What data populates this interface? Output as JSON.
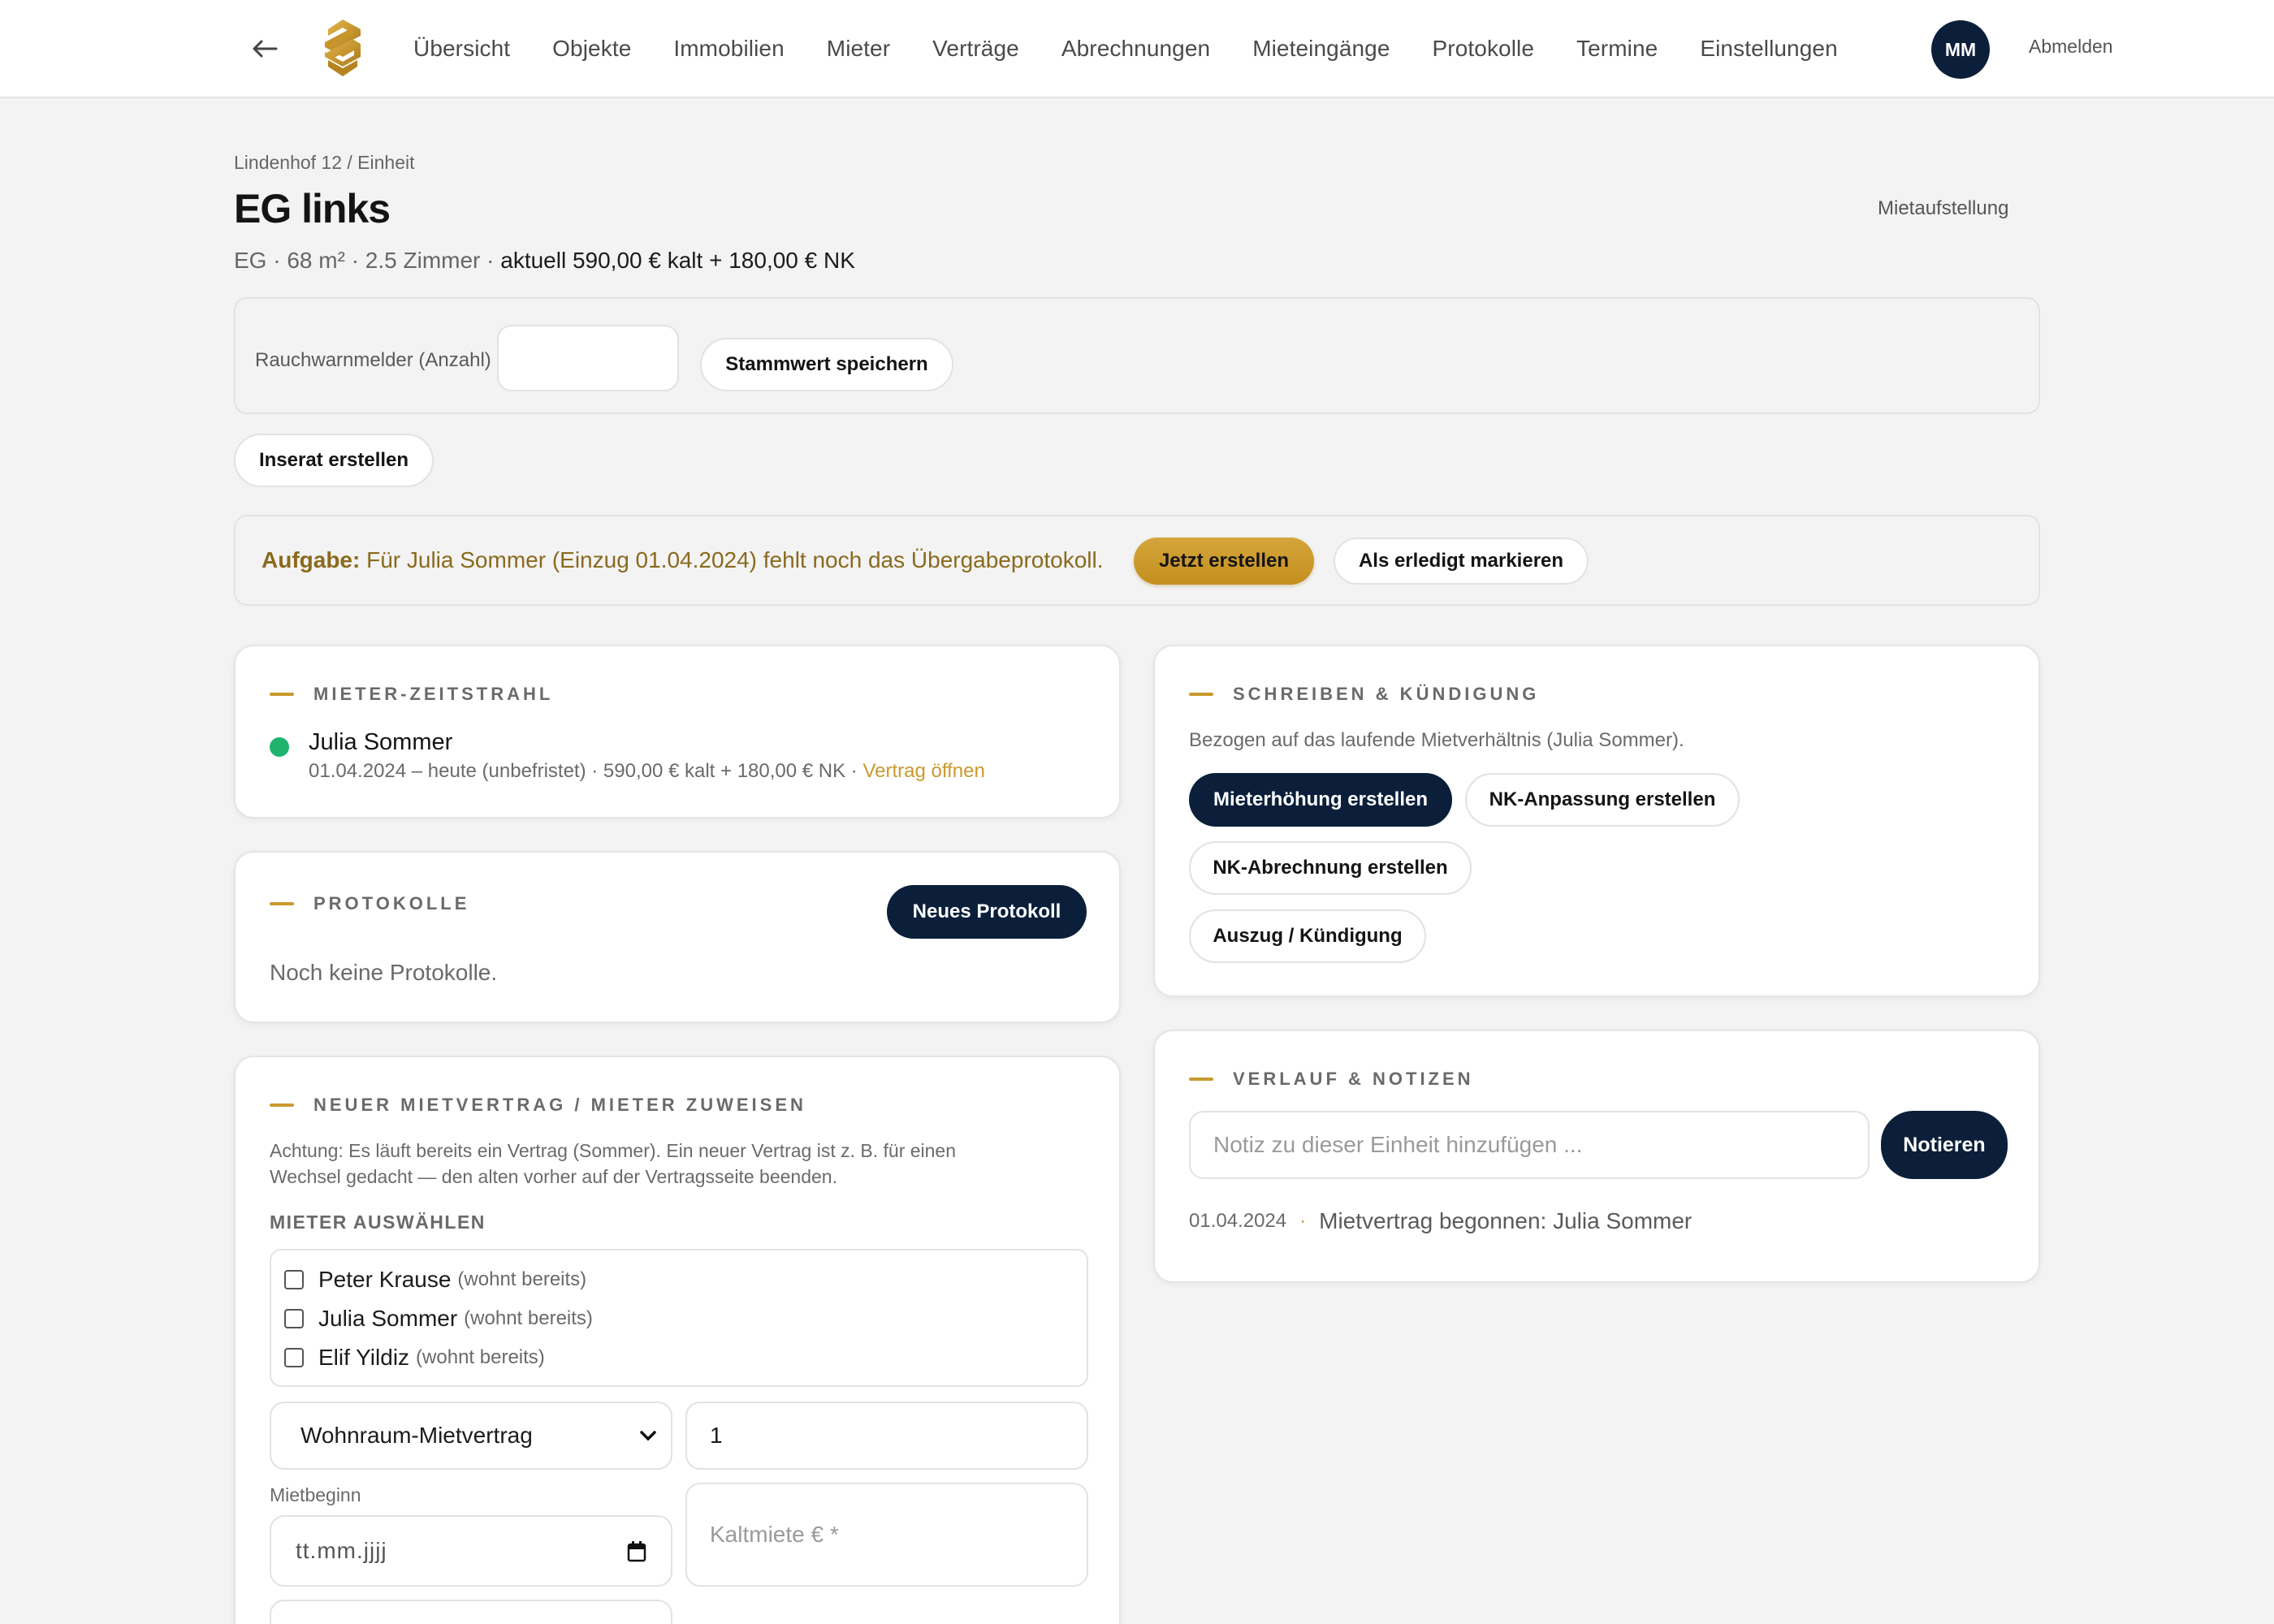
{
  "nav": {
    "back_icon": "arrow-left-icon",
    "logo": "brand-logo",
    "items": [
      "Übersicht",
      "Objekte",
      "Immobilien",
      "Mieter",
      "Verträge",
      "Abrechnungen",
      "Mieteingänge",
      "Protokolle",
      "Termine",
      "Einstellungen"
    ],
    "avatar_initials": "MM",
    "logout_label": "Abmelden"
  },
  "header": {
    "breadcrumb": "Lindenhof 12 / Einheit",
    "title": "EG links",
    "subline_prefix": "EG · 68 m² · 2.5 Zimmer · ",
    "subline_rent": "aktuell 590,00 € kalt + 180,00 € NK",
    "mietaufstellung_label": "Mietaufstellung"
  },
  "stammwert": {
    "label": "Rauchwarnmelder (Anzahl)",
    "value": "",
    "save_label": "Stammwert speichern"
  },
  "inserat_label": "Inserat erstellen",
  "task": {
    "prefix": "Aufgabe:",
    "text": " Für Julia Sommer (Einzug 01.04.2024) fehlt noch das Übergabeprotokoll.",
    "create_label": "Jetzt erstellen",
    "done_label": "Als erledigt markieren"
  },
  "timeline": {
    "heading": "MIETER-ZEITSTRAHL",
    "entry_name": "Julia Sommer",
    "entry_details": "01.04.2024 – heute (unbefristet) · 590,00 € kalt + 180,00 € NK · ",
    "entry_link": "Vertrag öffnen",
    "status_color": "#1fb36f"
  },
  "protocols": {
    "heading": "PROTOKOLLE",
    "new_label": "Neues Protokoll",
    "empty_text": "Noch keine Protokolle."
  },
  "new_contract": {
    "heading": "NEUER MIETVERTRAG / MIETER ZUWEISEN",
    "warning_line1": "Achtung: Es läuft bereits ein Vertrag (Sommer). Ein neuer Vertrag ist z. B. für einen",
    "warning_line2": "Wechsel gedacht — den alten vorher auf der Vertragsseite beenden.",
    "select_tenants_label": "MIETER AUSWÄHLEN",
    "tenants": [
      {
        "name": "Peter Krause",
        "note": "(wohnt bereits)",
        "checked": false
      },
      {
        "name": "Julia Sommer",
        "note": "(wohnt bereits)",
        "checked": false
      },
      {
        "name": "Elif Yildiz",
        "note": "(wohnt bereits)",
        "checked": false
      }
    ],
    "contract_type": "Wohnraum-Mietvertrag",
    "count_value": "1",
    "start_label": "Mietbeginn",
    "start_placeholder": "tt.mm.jjjj",
    "rent_placeholder": "Kaltmiete € *"
  },
  "letters": {
    "heading": "SCHREIBEN & KÜNDIGUNG",
    "subtitle": "Bezogen auf das laufende Mietverhältnis (Julia Sommer).",
    "btn_rent_increase": "Mieterhöhung erstellen",
    "btn_nk_adjust": "NK-Anpassung erstellen",
    "btn_nk_statement": "NK-Abrechnung erstellen",
    "btn_termination": "Auszug / Kündigung"
  },
  "history": {
    "heading": "VERLAUF & NOTIZEN",
    "note_placeholder": "Notiz zu dieser Einheit hinzufügen ...",
    "note_button": "Notieren",
    "entries": [
      {
        "date": "01.04.2024",
        "text": "Mietvertrag begonnen: Julia Sommer"
      }
    ]
  },
  "colors": {
    "accent_gold": "#c89a2e",
    "navy": "#0b1f3a",
    "task_text": "#8a6a1c"
  }
}
